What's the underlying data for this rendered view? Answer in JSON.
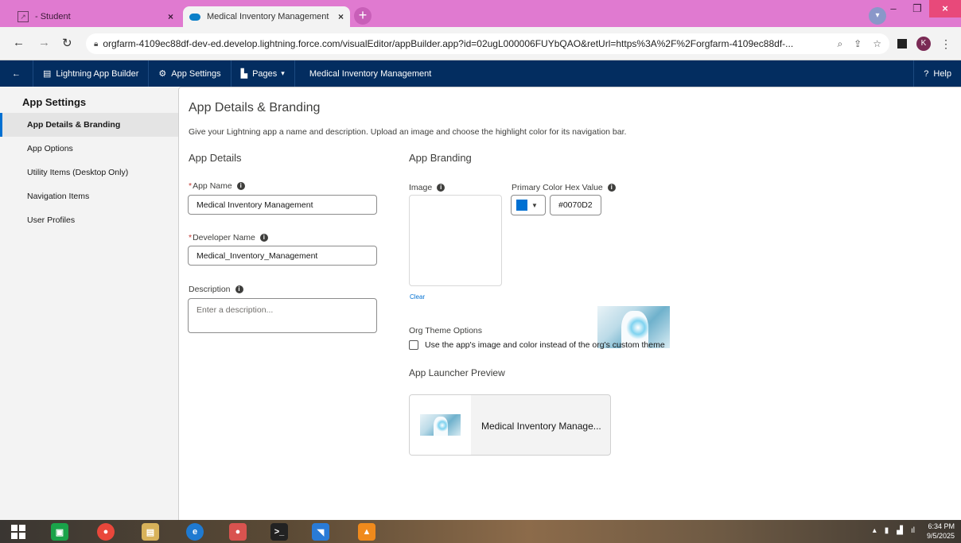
{
  "browser": {
    "tabs": [
      {
        "title": "- Student",
        "close": "×"
      },
      {
        "title": "Medical Inventory Management",
        "close": "×"
      }
    ],
    "new_tab": "+",
    "url": "orgfarm-4109ec88df-dev-ed.develop.lightning.force.com/visualEditor/appBuilder.app?id=02ugL000006FUYbQAO&retUrl=https%3A%2F%2Forgfarm-4109ec88df-...",
    "profile_initial": "K"
  },
  "header": {
    "back": "←",
    "app_builder": "Lightning App Builder",
    "app_settings": "App Settings",
    "pages": "Pages",
    "app_name": "Medical Inventory Management",
    "help": "Help"
  },
  "sidebar": {
    "title": "App Settings",
    "items": [
      {
        "label": "App Details & Branding"
      },
      {
        "label": "App Options"
      },
      {
        "label": "Utility Items (Desktop Only)"
      },
      {
        "label": "Navigation Items"
      },
      {
        "label": "User Profiles"
      }
    ]
  },
  "main": {
    "title": "App Details & Branding",
    "description": "Give your Lightning app a name and description. Upload an image and choose the highlight color for its navigation bar.",
    "details": {
      "heading": "App Details",
      "app_name_label": "App Name",
      "app_name_value": "Medical Inventory Management",
      "dev_name_label": "Developer Name",
      "dev_name_value": "Medical_Inventory_Management",
      "desc_label": "Description",
      "desc_placeholder": "Enter a description..."
    },
    "branding": {
      "heading": "App Branding",
      "image_label": "Image",
      "clear": "Clear",
      "color_label": "Primary Color Hex Value",
      "color_value": "#0070D2",
      "theme_label": "Org Theme Options",
      "theme_checkbox": "Use the app's image and color instead of the org's custom theme",
      "preview_label": "App Launcher Preview",
      "preview_name": "Medical Inventory Manage..."
    }
  },
  "taskbar": {
    "time": "6:34 PM",
    "date": "9/5/2025"
  },
  "colors": {
    "brand": "#0070d2",
    "header": "#032d60",
    "tabbar": "#e07ad0"
  }
}
